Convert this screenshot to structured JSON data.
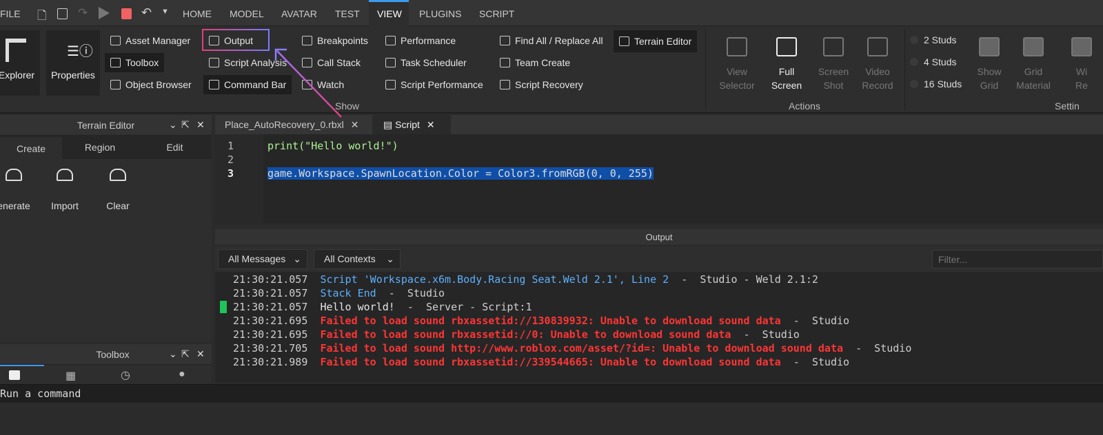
{
  "menu": {
    "file": "FILE",
    "tabs": [
      "HOME",
      "MODEL",
      "AVATAR",
      "TEST",
      "VIEW",
      "PLUGINS",
      "SCRIPT"
    ],
    "active": "VIEW"
  },
  "ribbon": {
    "explorer": "Explorer",
    "properties": "Properties",
    "col1": [
      "Asset Manager",
      "Toolbox",
      "Object Browser"
    ],
    "col2": [
      "Output",
      "Script Analysis",
      "Command Bar"
    ],
    "col3": [
      "Breakpoints",
      "Call Stack",
      "Watch"
    ],
    "col4": [
      "Performance",
      "Task Scheduler",
      "Script Performance"
    ],
    "col5": [
      "Find All / Replace All",
      "Team Create",
      "Script Recovery"
    ],
    "terrain": "Terrain Editor",
    "show_group": "Show",
    "actions": [
      {
        "l1": "View",
        "l2": "Selector"
      },
      {
        "l1": "Full",
        "l2": "Screen"
      },
      {
        "l1": "Screen",
        "l2": "Shot"
      },
      {
        "l1": "Video",
        "l2": "Record"
      }
    ],
    "actions_group": "Actions",
    "studs": [
      "2 Studs",
      "4 Studs",
      "16 Studs"
    ],
    "settings": [
      {
        "l1": "Show",
        "l2": "Grid"
      },
      {
        "l1": "Grid",
        "l2": "Material"
      },
      {
        "l1": "Wi",
        "l2": "Re"
      }
    ],
    "settings_group": "Settin"
  },
  "terrain_panel": {
    "title": "Terrain Editor",
    "tabs": [
      "Create",
      "Region",
      "Edit"
    ],
    "tools": [
      "enerate",
      "Import",
      "Clear"
    ]
  },
  "toolbox_panel": {
    "title": "Toolbox"
  },
  "editor": {
    "tabs": [
      "Place_AutoRecovery_0.rbxl",
      "Script"
    ],
    "lines": [
      "1",
      "2",
      "3"
    ],
    "code": [
      "print(\"Hello world!\")",
      "",
      "game.Workspace.SpawnLocation.Color = Color3.fromRGB(0, 0, 255)"
    ]
  },
  "output": {
    "title": "Output",
    "messages_filter": "All Messages",
    "contexts_filter": "All Contexts",
    "filter_placeholder": "Filter...",
    "logs": [
      {
        "t": "21:30:21.057",
        "msg": "Script 'Workspace.x6m.Body.Racing Seat.Weld 2.1', Line 2",
        "src": "  -  Studio - Weld 2.1:2",
        "kind": "b"
      },
      {
        "t": "21:30:21.057",
        "msg": "Stack End",
        "src": "  -  Studio",
        "kind": "b"
      },
      {
        "t": "21:30:21.057",
        "msg": "Hello world!",
        "src": "  -  Server - Script:1",
        "kind": "w"
      },
      {
        "t": "21:30:21.695",
        "msg": "Failed to load sound rbxassetid://130839932: Unable to download sound data",
        "src": "  -  Studio",
        "kind": "r"
      },
      {
        "t": "21:30:21.695",
        "msg": "Failed to load sound rbxassetid://0: Unable to download sound data",
        "src": "  -  Studio",
        "kind": "r"
      },
      {
        "t": "21:30:21.705",
        "msg": "Failed to load sound http://www.roblox.com/asset/?id=: Unable to download sound data",
        "src": "  -  Studio",
        "kind": "r"
      },
      {
        "t": "21:30:21.989",
        "msg": "Failed to load sound rbxassetid://339544665: Unable to download sound data",
        "src": "  -  Studio",
        "kind": "r"
      }
    ]
  },
  "command_bar": {
    "placeholder": "Run a command"
  },
  "colors": {
    "accent": "#3c9aee",
    "error": "#ff3535",
    "info": "#5cb0ff",
    "selection": "#0f4fa8",
    "annotation": "#e0407a"
  }
}
